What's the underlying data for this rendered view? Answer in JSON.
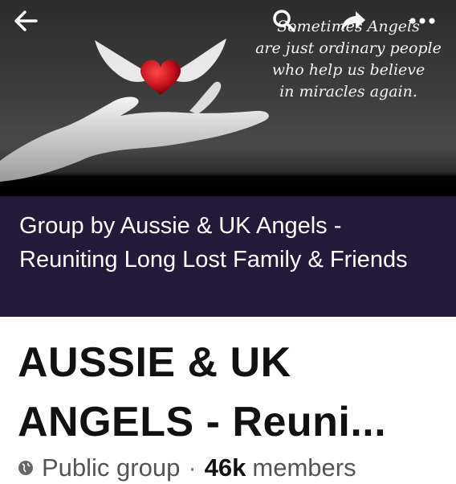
{
  "cover": {
    "quote_lines": [
      "Sometimes Angels",
      "are just ordinary people",
      "who help us believe",
      "in miracles again."
    ]
  },
  "topbar": {
    "back_icon": "arrow-left-icon",
    "search_icon": "search-icon",
    "share_icon": "share-icon",
    "more_icon": "more-horizontal-icon"
  },
  "band": {
    "title": "Group by Aussie & UK Angels - Reuniting Long Lost Family & Friends",
    "background": "#231a3a"
  },
  "group": {
    "name": "AUSSIE & UK ANGELS - Reuni...",
    "privacy_icon": "globe-icon",
    "privacy": "Public group",
    "separator": "·",
    "member_count": "46k",
    "members_label": "members"
  }
}
